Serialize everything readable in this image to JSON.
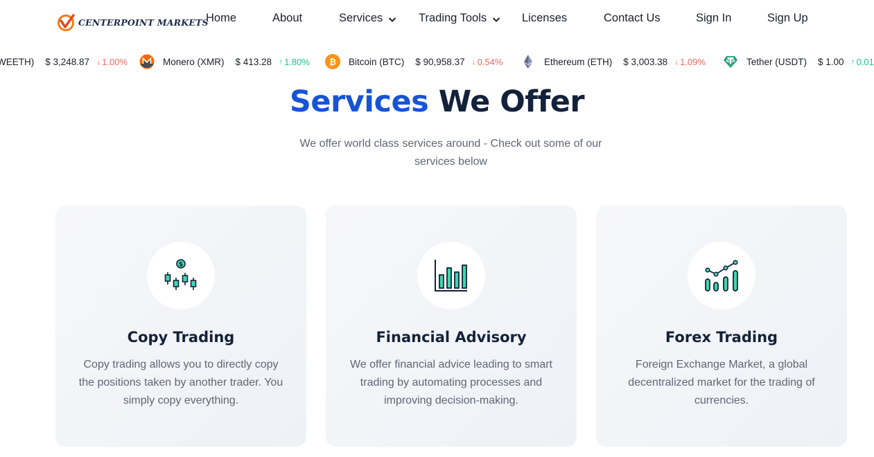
{
  "brand": {
    "name": "CENTERPOINT MARKETS"
  },
  "nav": {
    "home": "Home",
    "about": "About",
    "services": "Services",
    "trading_tools": "Trading Tools",
    "licenses": "Licenses",
    "contact": "Contact Us",
    "sign_in": "Sign In",
    "sign_up": "Sign Up"
  },
  "ticker": [
    {
      "name": "WEETH)",
      "price": "$ 3,248.87",
      "change": "1.00%",
      "direction": "down",
      "icon": ""
    },
    {
      "name": "Monero (XMR)",
      "price": "$ 413.28",
      "change": "1.80%",
      "direction": "up",
      "icon": "monero-icon"
    },
    {
      "name": "Bitcoin (BTC)",
      "price": "$ 90,958.37",
      "change": "0.54%",
      "direction": "down",
      "icon": "bitcoin-icon"
    },
    {
      "name": "Ethereum (ETH)",
      "price": "$ 3,003.38",
      "change": "1.09%",
      "direction": "down",
      "icon": "ethereum-icon"
    },
    {
      "name": "Tether (USDT)",
      "price": "$ 1.00",
      "change": "0.01",
      "direction": "up",
      "icon": "tether-icon"
    }
  ],
  "section": {
    "title_accent": "Services",
    "title_rest": " We Offer",
    "subtitle": "We offer world class services around - Check out some of our services below"
  },
  "cards": [
    {
      "title": "Copy Trading",
      "text": "Copy trading allows you to directly copy the positions taken by another trader. You simply copy everything.",
      "icon": "candlestick-dollar-icon"
    },
    {
      "title": "Financial Advisory",
      "text": "We offer financial advice leading to smart trading by automating processes and improving decision-making.",
      "icon": "bar-chart-icon"
    },
    {
      "title": "Forex Trading",
      "text": "Foreign Exchange Market, a global decentralized market for the trading of currencies.",
      "icon": "growth-chart-icon"
    }
  ],
  "colors": {
    "accent": "#1754d4",
    "heading": "#13213a",
    "up": "#1fbf8f",
    "down": "#f0685d",
    "icon_teal": "#3fd6b0"
  }
}
